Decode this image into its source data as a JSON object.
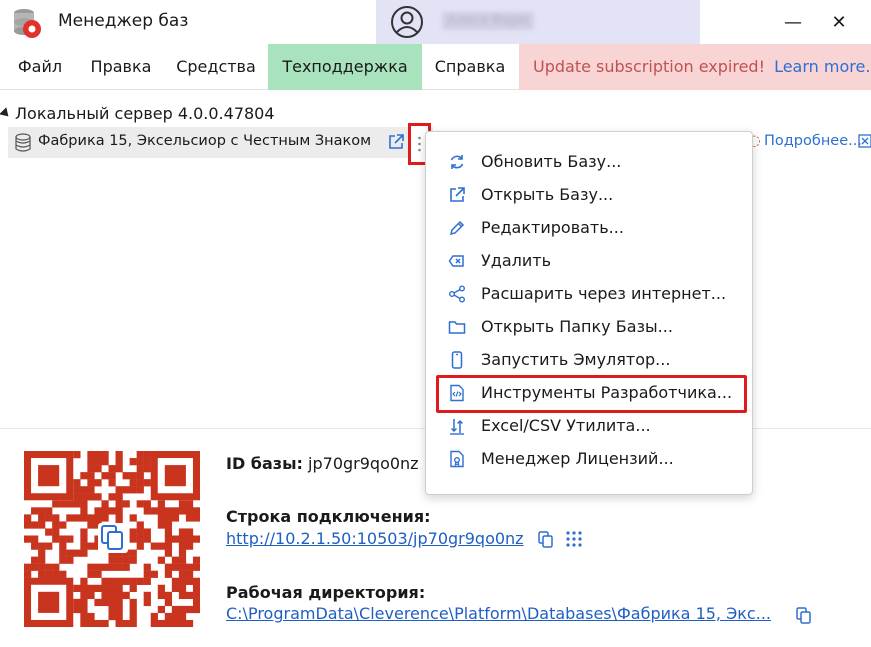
{
  "window": {
    "title": "Менеджер баз",
    "user_name": "Алеся Фарм",
    "minimize": "—",
    "maximize": "☐",
    "close": "✕"
  },
  "menu": {
    "items": [
      "Файл",
      "Правка",
      "Средства",
      "Техподдержка",
      "Справка"
    ],
    "notice_text": "Update subscription expired!",
    "notice_link": "Learn more..."
  },
  "tree": {
    "server": "Локальный сервер 4.0.0.47804",
    "database": "Фабрика 15, Эксельсиор с Честным Знаком",
    "more_link": "Подробнее..."
  },
  "context_menu": {
    "items": [
      {
        "label": "Обновить Базу...",
        "icon": "refresh-icon"
      },
      {
        "label": "Открыть Базу...",
        "icon": "open-external-icon"
      },
      {
        "label": "Редактировать...",
        "icon": "pencil-icon"
      },
      {
        "label": "Удалить",
        "icon": "delete-icon"
      },
      {
        "label": "Расшарить через интернет...",
        "icon": "share-icon"
      },
      {
        "label": "Открыть Папку Базы...",
        "icon": "folder-icon"
      },
      {
        "label": "Запустить Эмулятор...",
        "icon": "phone-icon"
      },
      {
        "label": "Инструменты Разработчика...",
        "icon": "code-icon"
      },
      {
        "label": "Excel/CSV Утилита...",
        "icon": "excel-util-icon"
      },
      {
        "label": "Менеджер Лицензий...",
        "icon": "license-icon"
      }
    ]
  },
  "details": {
    "id_label": "ID базы:",
    "id_value": "jp70gr9qo0nz",
    "conn_label": "Строка подключения:",
    "conn_value": "http://10.2.1.50:10503/jp70gr9qo0nz",
    "dir_label": "Рабочая директория:",
    "dir_value": "C:\\ProgramData\\Cleverence\\Platform\\Databases\\Фабрика 15, Экс..."
  },
  "colors": {
    "accent_blue": "#2f6fd3",
    "highlight_red": "#e01a1a",
    "support_green": "#a8e3bd",
    "notice_bg": "#f8d4d4",
    "notice_text": "#c45151",
    "qr_red": "#c9341f"
  }
}
